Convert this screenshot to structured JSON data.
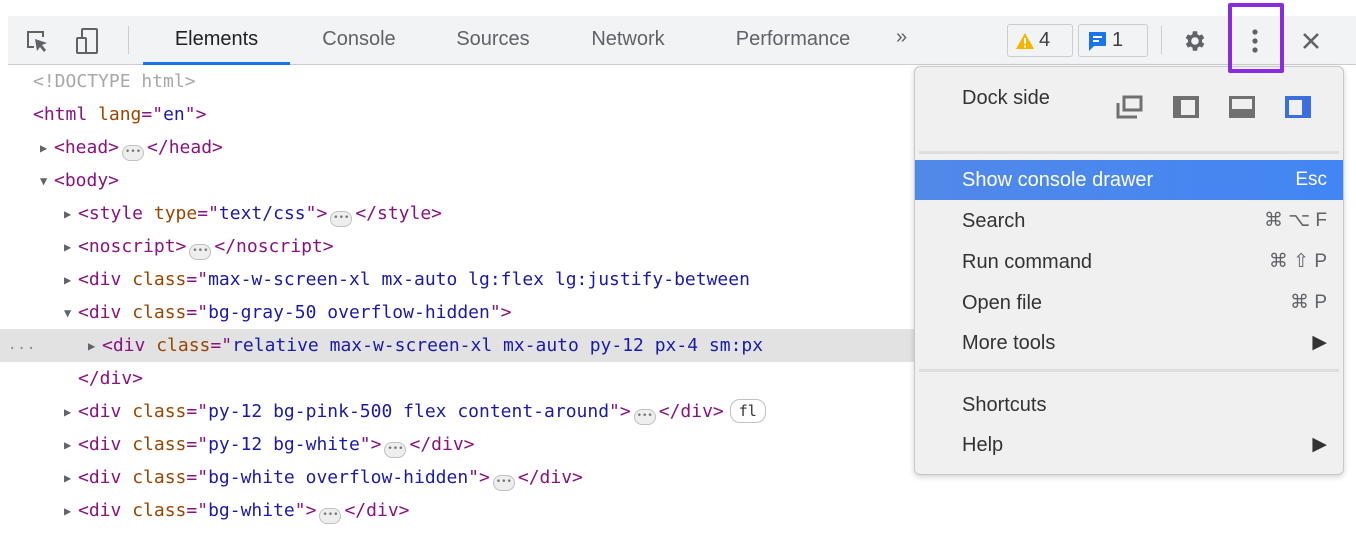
{
  "toolbar": {
    "tabs": [
      {
        "label": "Elements",
        "active": true
      },
      {
        "label": "Console",
        "active": false
      },
      {
        "label": "Sources",
        "active": false
      },
      {
        "label": "Network",
        "active": false
      },
      {
        "label": "Performance",
        "active": false
      }
    ],
    "more_tabs_glyph": "»",
    "warnings_count": "4",
    "messages_count": "1",
    "icons": {
      "inspect": "inspect-element-icon",
      "device": "device-toolbar-icon",
      "settings": "gear-icon",
      "more": "kebab-menu-icon",
      "close": "close-icon"
    },
    "highlight_color": "#8a2be2",
    "accent_color": "#1a73e8"
  },
  "dom_tree": {
    "rows": [
      {
        "doctype": "<!DOCTYPE html>"
      },
      {
        "open": "<html",
        "attr": "lang",
        "eq": "=\"",
        "val": "en",
        "close": "\">"
      },
      {
        "open": "<head>",
        "close": "</head>"
      },
      {
        "open": "<body>"
      },
      {
        "open": "<style",
        "attr": "type",
        "val": "text/css",
        "close": "</style>"
      },
      {
        "open": "<noscript>",
        "close": "</noscript>"
      },
      {
        "open": "<div",
        "attr": "class",
        "val": "max-w-screen-xl mx-auto lg:flex lg:justify-between"
      },
      {
        "open": "<div",
        "attr": "class",
        "val": "bg-gray-50 overflow-hidden",
        "end": "\">"
      },
      {
        "open": "<div",
        "attr": "class",
        "val": "relative max-w-screen-xl mx-auto py-12 px-4 sm:px",
        "gutter": "..."
      },
      {
        "close": "</div>"
      },
      {
        "open": "<div",
        "attr": "class",
        "val": "py-12 bg-pink-500 flex content-around",
        "close": "</div>",
        "badge": "fl"
      },
      {
        "open": "<div",
        "attr": "class",
        "val": "py-12 bg-white",
        "close": "</div>"
      },
      {
        "open": "<div",
        "attr": "class",
        "val": "bg-white overflow-hidden",
        "close": "</div>"
      },
      {
        "open": "<div",
        "attr": "class",
        "val": "bg-white",
        "close": "</div>"
      }
    ]
  },
  "menu": {
    "dock_side_label": "Dock side",
    "dock_options": [
      "undock-icon",
      "dock-left-icon",
      "dock-bottom-icon",
      "dock-right-icon"
    ],
    "dock_selected": "dock-right-icon",
    "items": [
      {
        "label": "Show console drawer",
        "shortcut": "Esc",
        "active": true
      },
      {
        "label": "Search",
        "shortcut": "⌘ ⌥ F"
      },
      {
        "label": "Run command",
        "shortcut": "⌘ ⇧ P"
      },
      {
        "label": "Open file",
        "shortcut": "⌘ P"
      },
      {
        "label": "More tools",
        "shortcut": "▶"
      },
      {
        "label": "Shortcuts",
        "shortcut": ""
      },
      {
        "label": "Help",
        "shortcut": "▶"
      }
    ]
  }
}
